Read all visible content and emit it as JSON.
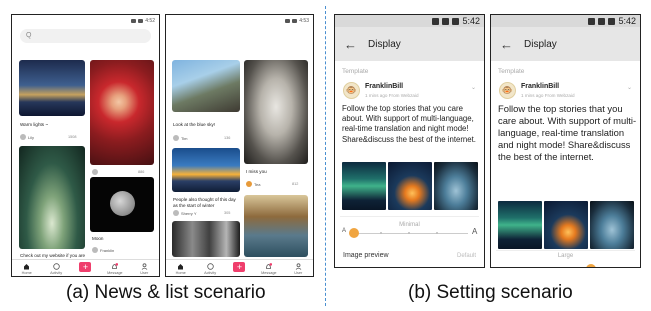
{
  "phone1": {
    "status": "4:52",
    "search_placeholder": "Q",
    "cards": [
      {
        "text": "Warm lights ~",
        "user": "Lily",
        "likes": "1508"
      },
      {
        "user": "",
        "likes": "886"
      },
      {
        "text": "Moon",
        "user": "Franklin",
        "likes": ""
      },
      {
        "text": "Check out my website if you are interested to learn my workflow an...",
        "user": "",
        "likes": ""
      }
    ],
    "tabs": [
      {
        "label": "Home",
        "icon": "home-icon"
      },
      {
        "label": "Activity",
        "icon": "compass-icon"
      },
      {
        "label": "",
        "icon": "plus-icon"
      },
      {
        "label": "Message",
        "icon": "bell-icon"
      },
      {
        "label": "User",
        "icon": "user-icon"
      }
    ]
  },
  "phone2": {
    "status": "4:53",
    "cards": [
      {
        "text": "Look at the blue sky!",
        "user": "Tim",
        "likes": "136"
      },
      {
        "text": "I miss you",
        "user": "Tea",
        "likes": "812"
      },
      {
        "text": "People also thought of this day as the start of winter",
        "user": "Sherry Y",
        "likes": "305"
      }
    ],
    "tabs": [
      {
        "label": "Home",
        "icon": "home-icon"
      },
      {
        "label": "Activity",
        "icon": "compass-icon"
      },
      {
        "label": "",
        "icon": "plus-icon"
      },
      {
        "label": "Message",
        "icon": "bell-icon"
      },
      {
        "label": "User",
        "icon": "user-icon"
      }
    ]
  },
  "settings1": {
    "time": "5:42",
    "title": "Display",
    "section": "Template",
    "name": "FranklinBill",
    "meta": "1 mins ago   From Webzaid",
    "body": "Follow the top stories that you care about. With support of multi-language, real-time translation and night mode! Share&discuss the best of the internet.",
    "font_size_label": "Minimal",
    "small_a": "A",
    "big_a": "A",
    "image_preview": "Image preview",
    "image_preview_value": "Default"
  },
  "settings2": {
    "time": "5:42",
    "title": "Display",
    "section": "Template",
    "name": "FranklinBill",
    "meta": "1 mins ago   From Webzaid",
    "body": "Follow the top stories that you care about. With support of multi-language, real-time translation and night mode! Share&discuss the best of the internet.",
    "font_size_label": "Large"
  },
  "captions": {
    "left": "(a) News & list scenario",
    "right": "(b) Setting scenario"
  },
  "colors": {
    "accent_pink": "#ef3e6c",
    "slider_orange": "#f0a541",
    "divider_blue": "#4a8fd0"
  }
}
